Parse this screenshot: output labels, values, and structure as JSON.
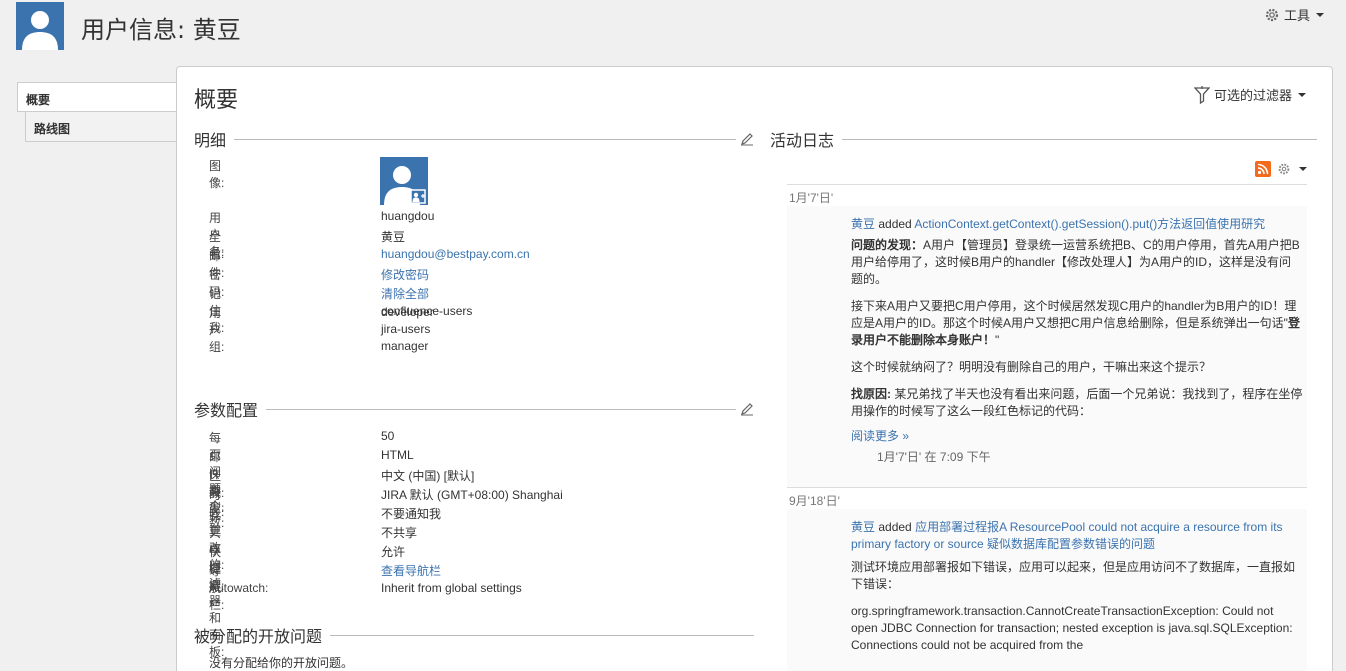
{
  "header": {
    "title": "用户信息: 黄豆",
    "tools_label": "工具"
  },
  "tabs": [
    {
      "label": "概要"
    },
    {
      "label": "路线图"
    }
  ],
  "main": {
    "title": "概要",
    "filter_label": "可选的过滤器"
  },
  "details": {
    "heading": "明细",
    "image_label": "图像:",
    "rows": [
      {
        "k": "用户名:",
        "v": "huangdou"
      },
      {
        "k": "全名:",
        "v": "黄豆"
      },
      {
        "k": "邮件:",
        "v": "huangdou@bestpay.com.cn"
      },
      {
        "k": "密码:",
        "v": "修改密码"
      },
      {
        "k": "记住我:",
        "v": "清除全部"
      },
      {
        "k": "用户组:",
        "v": "confluence-users"
      }
    ],
    "groups": [
      "developer",
      "jira-users",
      "manager"
    ]
  },
  "prefs": {
    "heading": "参数配置",
    "rows": [
      {
        "k": "每页问题个数:",
        "v": "50"
      },
      {
        "k": "邮件类型:",
        "v": "HTML"
      },
      {
        "k": "区域:",
        "v": "中文 (中国) [默认]"
      },
      {
        "k": "时区:",
        "v": "JIRA 默认 (GMT+08:00) Shanghai"
      },
      {
        "k": "我更改的:",
        "v": "不要通知我"
      },
      {
        "k": "共享过滤器和面板:",
        "v": "不共享"
      },
      {
        "k": "快捷键:",
        "v": "允许"
      },
      {
        "k": "导航栏:",
        "v": "查看导航栏"
      },
      {
        "k": "Autowatch:",
        "v": "Inherit from global settings"
      }
    ]
  },
  "assigned": {
    "heading": "被分配的开放问题",
    "empty": "没有分配给你的开放问题。"
  },
  "activity": {
    "heading": "活动日志",
    "groups": [
      {
        "date": "1月'7'日'",
        "who": "黄豆",
        "action": "added",
        "title": "ActionContext.getContext().getSession().put()方法返回值使用研究",
        "p1_bold": "问题的发现：",
        "p1": "A用户【管理员】登录统一运营系统把B、C的用户停用，首先A用户把B用户给停用了，这时候B用户的handler【修改处理人】为A用户的ID，这样是没有问题的。",
        "p2a": "接下来A用户又要把C用户停用，这个时候居然发现C用户的handler为B用户的ID！理应是A用户的ID。那这个时候A用户又想把C用户信息给删除，但是系统弹出一句话\"",
        "p2_bold": "登录用户不能删除本身账户！",
        "p2b": "\"",
        "p3": "这个时候就纳闷了？明明没有删除自己的用户，干嘛出来这个提示？",
        "p4_bold": "找原因:",
        "p4": "某兄弟找了半天也没有看出来问题，后面一个兄弟说：我找到了，程序在坐停用操作的时候写了这么一段红色标记的代码：",
        "read_more": "阅读更多 »",
        "stamp": "1月'7'日' 在 7:09 下午"
      },
      {
        "date": "9月'18'日'",
        "who": "黄豆",
        "action": "added",
        "title": "应用部署过程报A ResourcePool could not acquire a resource from its primary factory or source 疑似数据库配置参数错误的问题",
        "p1": "测试环境应用部署报如下错误，应用可以起来，但是应用访问不了数据库，一直报如下错误：",
        "p2": "org.springframework.transaction.CannotCreateTransactionException: Could not open JDBC Connection for transaction; nested exception is java.sql.SQLException: Connections could not be acquired from the"
      }
    ]
  },
  "colors": {
    "link": "#3b73af",
    "rss": "#f26a1b",
    "avatar": "#3b73af"
  }
}
